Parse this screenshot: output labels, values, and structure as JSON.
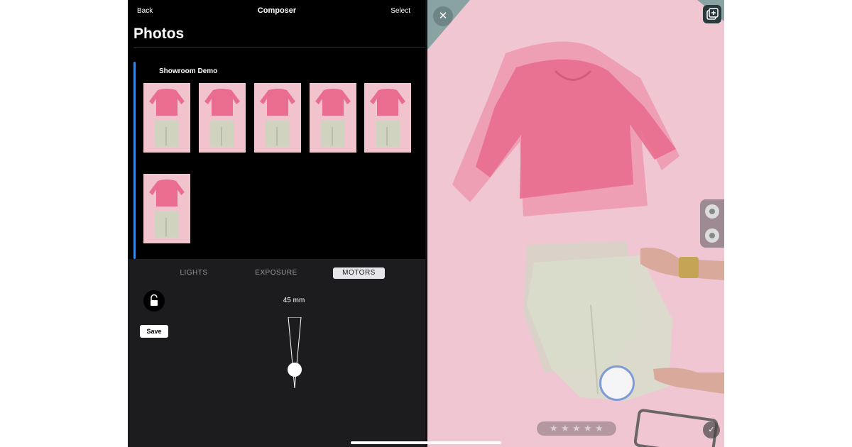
{
  "topbar": {
    "back_label": "Back",
    "title": "Composer",
    "select_label": "Select"
  },
  "page_title": "Photos",
  "album": {
    "title": "Showroom Demo",
    "photos": [
      {
        "icon": "sweatshirt-and-pants-photo"
      },
      {
        "icon": "sweatshirt-and-pants-photo"
      },
      {
        "icon": "sweatshirt-and-pants-photo"
      },
      {
        "icon": "sweatshirt-and-pants-photo"
      },
      {
        "icon": "sweatshirt-and-pants-photo"
      },
      {
        "icon": "sweatshirt-and-pants-photo"
      }
    ]
  },
  "controls": {
    "tabs": [
      {
        "label": "LIGHTS",
        "active": false
      },
      {
        "label": "EXPOSURE",
        "active": false
      },
      {
        "label": "MOTORS",
        "active": true
      }
    ],
    "lock_icon": "unlock-icon",
    "save_label": "Save",
    "focal_length": "45 mm"
  },
  "viewfinder": {
    "close_glyph": "✕",
    "check_glyph": "✓",
    "star_glyph": "★",
    "rating": {
      "stars": 5,
      "selected": 0
    },
    "icons": [
      "close-icon",
      "gallery-icon",
      "settings-dial-icon",
      "shutter-button",
      "check-icon"
    ]
  },
  "colors": {
    "accent": "#3a87e0",
    "background_pink": "#efc6d2",
    "sweatshirt": "#ea6d8f",
    "pants": "#cfd3bf"
  }
}
